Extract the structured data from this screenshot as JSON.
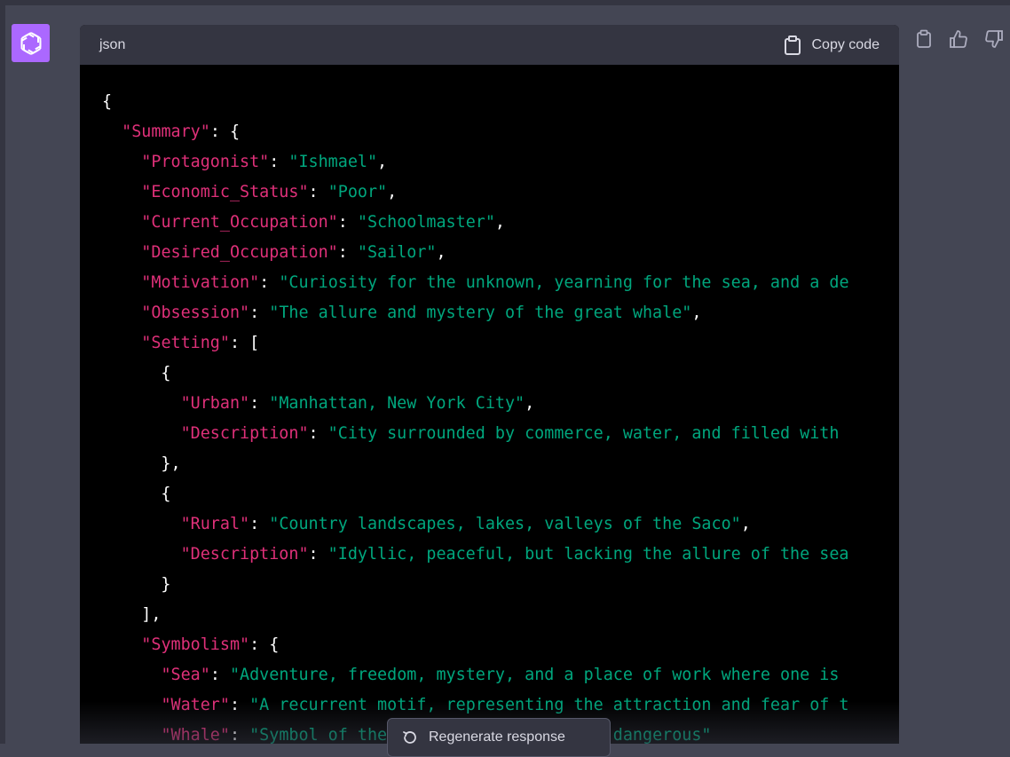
{
  "header": {
    "language": "json",
    "copy_label": "Copy code"
  },
  "actions": {
    "regenerate_label": "Regenerate response",
    "icons": [
      "clipboard-icon",
      "thumbs-up-icon",
      "thumbs-down-icon"
    ]
  },
  "colors": {
    "page_bg": "#444654",
    "avatar_bg": "#ab68ff",
    "code_bg": "#000000",
    "key": "#df3079",
    "string": "#00a67d"
  },
  "code_lines": [
    [
      {
        "t": "p",
        "v": "{"
      }
    ],
    [
      {
        "t": "p",
        "v": "  "
      },
      {
        "t": "k",
        "v": "\"Summary\""
      },
      {
        "t": "p",
        "v": ": {"
      }
    ],
    [
      {
        "t": "p",
        "v": "    "
      },
      {
        "t": "k",
        "v": "\"Protagonist\""
      },
      {
        "t": "p",
        "v": ": "
      },
      {
        "t": "s",
        "v": "\"Ishmael\""
      },
      {
        "t": "p",
        "v": ","
      }
    ],
    [
      {
        "t": "p",
        "v": "    "
      },
      {
        "t": "k",
        "v": "\"Economic_Status\""
      },
      {
        "t": "p",
        "v": ": "
      },
      {
        "t": "s",
        "v": "\"Poor\""
      },
      {
        "t": "p",
        "v": ","
      }
    ],
    [
      {
        "t": "p",
        "v": "    "
      },
      {
        "t": "k",
        "v": "\"Current_Occupation\""
      },
      {
        "t": "p",
        "v": ": "
      },
      {
        "t": "s",
        "v": "\"Schoolmaster\""
      },
      {
        "t": "p",
        "v": ","
      }
    ],
    [
      {
        "t": "p",
        "v": "    "
      },
      {
        "t": "k",
        "v": "\"Desired_Occupation\""
      },
      {
        "t": "p",
        "v": ": "
      },
      {
        "t": "s",
        "v": "\"Sailor\""
      },
      {
        "t": "p",
        "v": ","
      }
    ],
    [
      {
        "t": "p",
        "v": "    "
      },
      {
        "t": "k",
        "v": "\"Motivation\""
      },
      {
        "t": "p",
        "v": ": "
      },
      {
        "t": "s",
        "v": "\"Curiosity for the unknown, yearning for the sea, and a de"
      }
    ],
    [
      {
        "t": "p",
        "v": "    "
      },
      {
        "t": "k",
        "v": "\"Obsession\""
      },
      {
        "t": "p",
        "v": ": "
      },
      {
        "t": "s",
        "v": "\"The allure and mystery of the great whale\""
      },
      {
        "t": "p",
        "v": ","
      }
    ],
    [
      {
        "t": "p",
        "v": "    "
      },
      {
        "t": "k",
        "v": "\"Setting\""
      },
      {
        "t": "p",
        "v": ": ["
      }
    ],
    [
      {
        "t": "p",
        "v": "      {"
      }
    ],
    [
      {
        "t": "p",
        "v": "        "
      },
      {
        "t": "k",
        "v": "\"Urban\""
      },
      {
        "t": "p",
        "v": ": "
      },
      {
        "t": "s",
        "v": "\"Manhattan, New York City\""
      },
      {
        "t": "p",
        "v": ","
      }
    ],
    [
      {
        "t": "p",
        "v": "        "
      },
      {
        "t": "k",
        "v": "\"Description\""
      },
      {
        "t": "p",
        "v": ": "
      },
      {
        "t": "s",
        "v": "\"City surrounded by commerce, water, and filled with"
      }
    ],
    [
      {
        "t": "p",
        "v": "      },"
      }
    ],
    [
      {
        "t": "p",
        "v": "      {"
      }
    ],
    [
      {
        "t": "p",
        "v": "        "
      },
      {
        "t": "k",
        "v": "\"Rural\""
      },
      {
        "t": "p",
        "v": ": "
      },
      {
        "t": "s",
        "v": "\"Country landscapes, lakes, valleys of the Saco\""
      },
      {
        "t": "p",
        "v": ","
      }
    ],
    [
      {
        "t": "p",
        "v": "        "
      },
      {
        "t": "k",
        "v": "\"Description\""
      },
      {
        "t": "p",
        "v": ": "
      },
      {
        "t": "s",
        "v": "\"Idyllic, peaceful, but lacking the allure of the sea"
      }
    ],
    [
      {
        "t": "p",
        "v": "      }"
      }
    ],
    [
      {
        "t": "p",
        "v": "    ],"
      }
    ],
    [
      {
        "t": "p",
        "v": "    "
      },
      {
        "t": "k",
        "v": "\"Symbolism\""
      },
      {
        "t": "p",
        "v": ": {"
      }
    ],
    [
      {
        "t": "p",
        "v": "      "
      },
      {
        "t": "k",
        "v": "\"Sea\""
      },
      {
        "t": "p",
        "v": ": "
      },
      {
        "t": "s",
        "v": "\"Adventure, freedom, mystery, and a place of work where one is"
      }
    ],
    [
      {
        "t": "p",
        "v": "      "
      },
      {
        "t": "k",
        "v": "\"Water\""
      },
      {
        "t": "p",
        "v": ": "
      },
      {
        "t": "s",
        "v": "\"A recurrent motif, representing the attraction and fear of t"
      }
    ],
    [
      {
        "t": "p",
        "v": "      "
      },
      {
        "t": "k",
        "v": "\"Whale\""
      },
      {
        "t": "p",
        "v": ": "
      },
      {
        "t": "s",
        "v": "\"Symbol of the unknown, powerful and dangerous\""
      }
    ]
  ]
}
